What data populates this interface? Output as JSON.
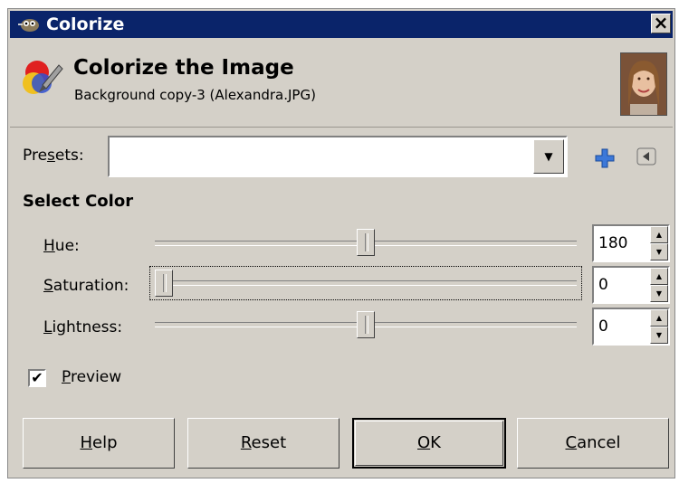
{
  "window": {
    "title": "Colorize",
    "close_glyph": "×"
  },
  "header": {
    "title": "Colorize the Image",
    "subtitle": "Background copy-3 (Alexandra.JPG)",
    "thumbnail_icon": "image-thumbnail"
  },
  "presets": {
    "label_pre": "Pre",
    "label_accel": "s",
    "label_post": "ets:",
    "value": "",
    "add_icon": "plus-icon",
    "menu_icon": "menu-triangle-icon"
  },
  "select_color": {
    "heading": "Select Color",
    "sliders": [
      {
        "accel": "H",
        "rest": "ue:",
        "value": "180",
        "fraction": 0.5
      },
      {
        "accel": "S",
        "rest": "aturation:",
        "value": "0",
        "fraction": 0.0
      },
      {
        "accel": "L",
        "rest": "ightness:",
        "value": "0",
        "fraction": 0.5
      }
    ]
  },
  "preview": {
    "checked": true,
    "check_glyph": "✔",
    "accel": "P",
    "rest": "review"
  },
  "buttons": {
    "help": {
      "accel": "H",
      "rest": "elp"
    },
    "reset": {
      "accel": "R",
      "rest": "eset"
    },
    "ok": {
      "accel": "O",
      "rest": "K"
    },
    "cancel": {
      "accel": "C",
      "rest": "ancel"
    }
  },
  "colors": {
    "titlebar": "#0a246a",
    "dialog": "#d4d0c8",
    "accent_plus": "#3c78d8"
  }
}
